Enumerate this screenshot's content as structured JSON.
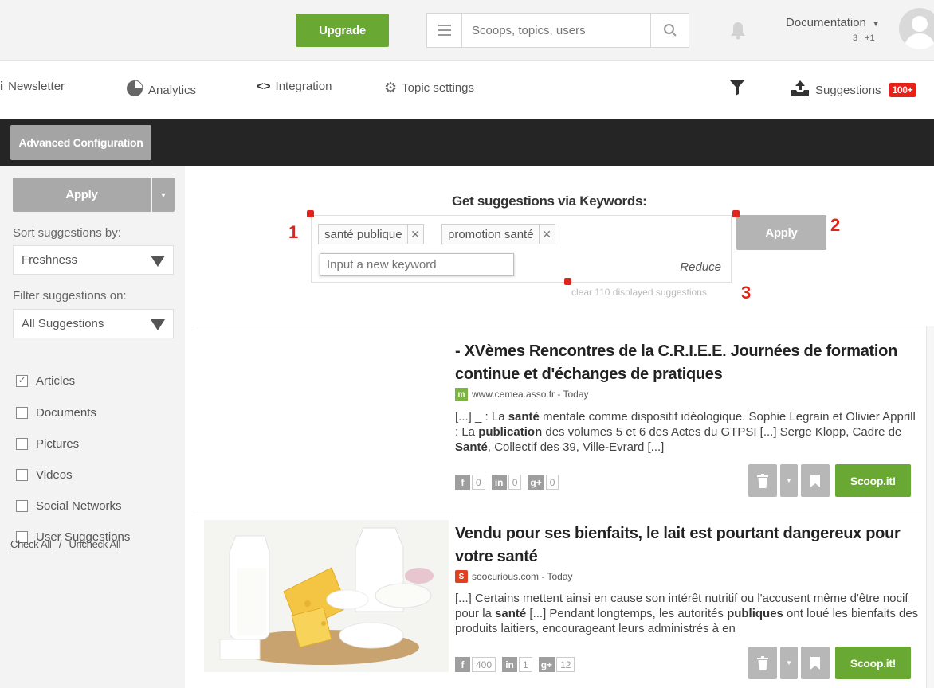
{
  "topbar": {
    "upgrade_label": "Upgrade",
    "search_placeholder": "Scoops, topics, users",
    "user_name": "Documentation",
    "user_sub": "3 | +1"
  },
  "nav": {
    "newsletter": "Newsletter",
    "analytics": "Analytics",
    "integration": "Integration",
    "topic_settings": "Topic settings",
    "suggestions": "Suggestions",
    "suggestions_badge": "100+"
  },
  "darkbar": {
    "advanced_label": "Advanced Configuration"
  },
  "sidebar": {
    "apply_label": "Apply",
    "sort_label": "Sort suggestions by:",
    "sort_value": "Freshness",
    "filter_label": "Filter suggestions on:",
    "filter_value": "All Suggestions",
    "checkboxes": [
      {
        "label": "Articles",
        "checked": true
      },
      {
        "label": "Documents",
        "checked": false
      },
      {
        "label": "Pictures",
        "checked": false
      },
      {
        "label": "Videos",
        "checked": false
      },
      {
        "label": "Social Networks",
        "checked": false
      },
      {
        "label": "User Suggestions",
        "checked": false
      }
    ],
    "check_all": "Check All",
    "check_sep": "/",
    "uncheck_all": "Uncheck All"
  },
  "keywords": {
    "title": "Get suggestions via Keywords:",
    "tags": [
      "santé publique",
      "promotion santé"
    ],
    "input_placeholder": "Input a new keyword",
    "reduce_label": "Reduce",
    "apply_label": "Apply",
    "clear_label": "clear 110 displayed suggestions",
    "annotations": [
      "1",
      "2",
      "3"
    ]
  },
  "articles": [
    {
      "title": "- XVèmes Rencontres de la C.R.I.E.E. Journées de formation continue et d'échanges de pratiques",
      "source": "www.cemea.asso.fr - Today",
      "excerpt_html": "[...] _ : La <b>santé</b> mentale comme dispositif idéologique. Sophie Legrain et Olivier Apprill : La <b>publication</b> des volumes 5 et 6 des Actes du GTPSI [...] Serge Klopp, Cadre de <b>Santé</b>, Collectif des 39, Ville-Evrard [...]",
      "facebook": "0",
      "linkedin": "0",
      "gplus": "0",
      "scoop_label": "Scoop.it!"
    },
    {
      "title": "Vendu pour ses bienfaits, le lait est pourtant dangereux pour votre santé",
      "source": "soocurious.com - Today",
      "excerpt_html": "[...] Certains mettent ainsi en cause son intérêt nutritif ou l'accusent même d'être nocif pour la <b>santé</b> [...] Pendant longtemps, les autorités <b>publiques</b> ont loué les bienfaits des produits laitiers, encourageant leurs administrés à en",
      "facebook": "400",
      "linkedin": "1",
      "gplus": "12",
      "scoop_label": "Scoop.it!"
    }
  ],
  "colors": {
    "green": "#6aa834",
    "annotation_red": "#e0241b",
    "dark_bar": "#252525"
  }
}
